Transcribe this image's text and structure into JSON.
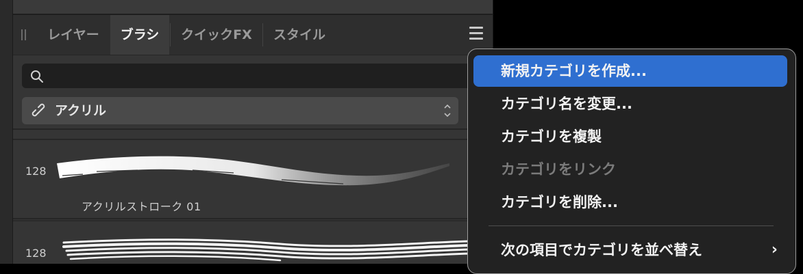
{
  "panel": {
    "tabs": [
      {
        "label": "レイヤー",
        "active": false
      },
      {
        "label": "ブラシ",
        "active": true
      },
      {
        "label": "クイックFX",
        "active": false
      },
      {
        "label": "スタイル",
        "active": false
      }
    ],
    "search": {
      "placeholder": ""
    },
    "category": {
      "label": "アクリル"
    },
    "brushes": [
      {
        "size": "128",
        "name": "アクリルストローク 01"
      },
      {
        "size": "128",
        "name": ""
      }
    ]
  },
  "context_menu": {
    "items": [
      {
        "label": "新規カテゴリを作成...",
        "state": "highlighted"
      },
      {
        "label": "カテゴリ名を変更...",
        "state": "enabled"
      },
      {
        "label": "カテゴリを複製",
        "state": "enabled"
      },
      {
        "label": "カテゴリをリンク",
        "state": "disabled"
      },
      {
        "label": "カテゴリを削除...",
        "state": "enabled"
      },
      {
        "label": "次の項目でカテゴリを並べ替え",
        "state": "enabled",
        "submenu": true
      }
    ],
    "highlight_color": "#2f6fd0"
  }
}
